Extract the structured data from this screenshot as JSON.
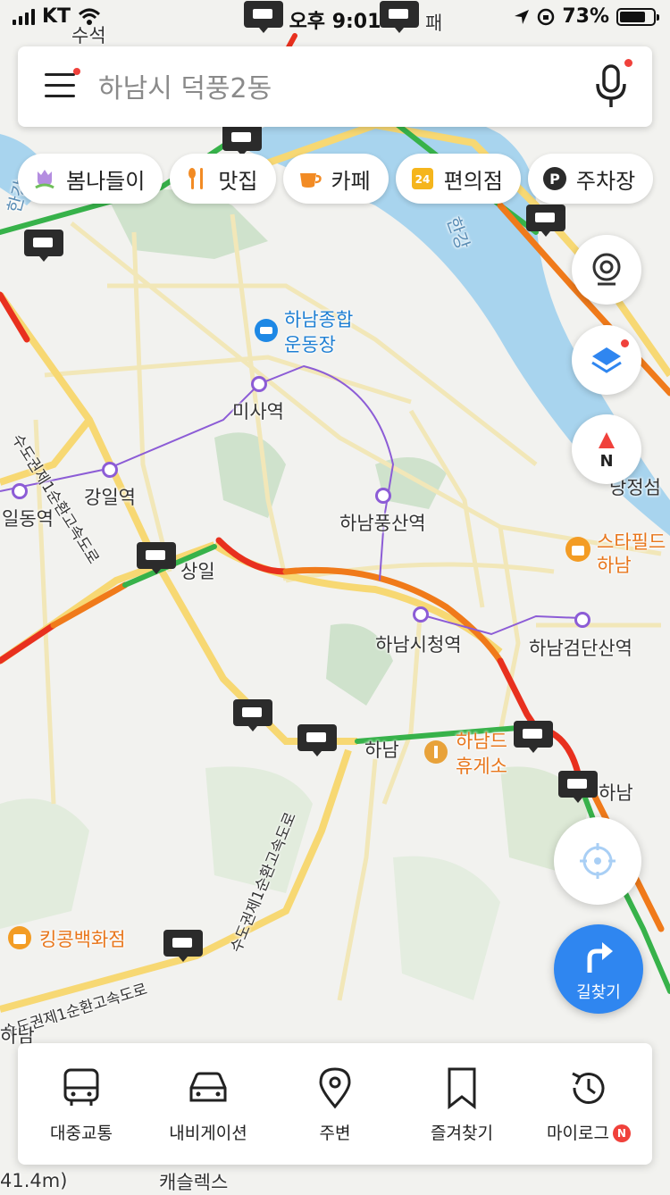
{
  "status_bar": {
    "carrier": "KT",
    "time": "오후 9:01",
    "battery": "73%"
  },
  "search": {
    "placeholder": "하남시 덕풍2동"
  },
  "categories": [
    {
      "label": "봄나들이",
      "icon": "tulip-icon"
    },
    {
      "label": "맛집",
      "icon": "restaurant-icon"
    },
    {
      "label": "카페",
      "icon": "coffee-icon"
    },
    {
      "label": "편의점",
      "icon": "convenience-store-icon"
    },
    {
      "label": "주차장",
      "icon": "parking-icon"
    }
  ],
  "map_labels": {
    "sports_complex": "하남종합\n운동장",
    "misa_station": "미사역",
    "gangil_station": "강일역",
    "ildong_station": "일동역",
    "pungsan_station": "하남풍산역",
    "cityhall_station": "하남시청역",
    "geomdansan_station": "하남검단산역",
    "sangil": "상일",
    "hanam_ic": "하남",
    "rest_area": "하남드\n휴게소",
    "starfield": "스타필드\n하남",
    "kingkong": "킹콩백화점",
    "river": "한강",
    "river_left": "한강",
    "expressway_1": "수도권제1순환고속도로",
    "expressway_2": "수도권제1순환고속도로",
    "expressway_3": "수도권제1순환고속도로",
    "dangjeong": "당정섬",
    "hanam_right": "하남",
    "capsule": "캐슬렉스",
    "suseok": "수석",
    "bottom_left": "하남",
    "distance": "41.4m)",
    "top_partial": "패"
  },
  "controls": {
    "cctv": "cctv-icon",
    "layers": "layers-icon",
    "compass": "N",
    "locate": "crosshair-icon",
    "route_label": "길찾기"
  },
  "bottom_nav": [
    {
      "label": "대중교통",
      "icon": "bus-icon"
    },
    {
      "label": "내비게이션",
      "icon": "car-icon"
    },
    {
      "label": "주변",
      "icon": "location-pin-icon"
    },
    {
      "label": "즐겨찾기",
      "icon": "bookmark-icon"
    },
    {
      "label": "마이로그",
      "icon": "history-icon",
      "badge": "N"
    }
  ],
  "colors": {
    "accent": "#2f86f0",
    "water": "#a8d4ee",
    "park": "#cfe2cc",
    "traffic_red": "#e8301e",
    "traffic_orange": "#f07a1a",
    "traffic_green": "#37b24a",
    "road_yellow": "#f7d873",
    "subway": "#8c5cd6"
  }
}
